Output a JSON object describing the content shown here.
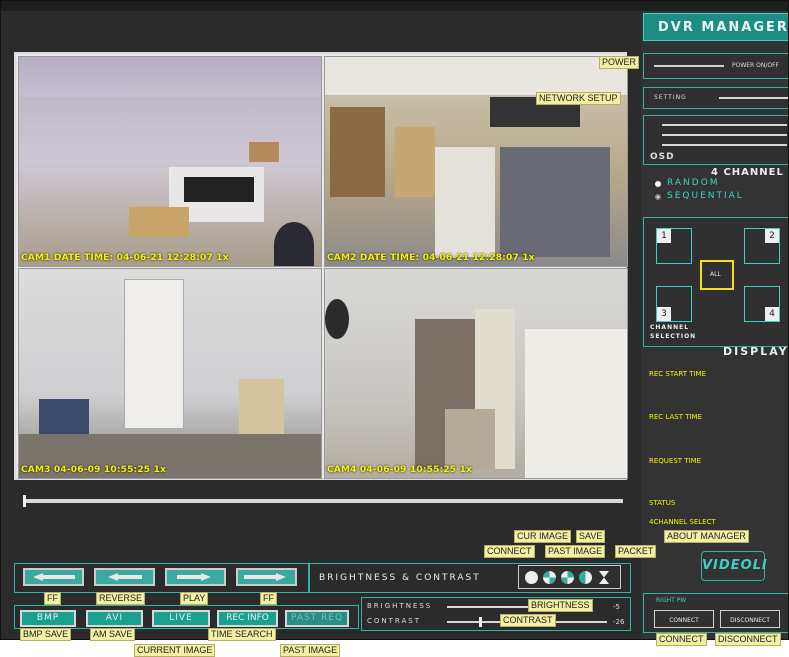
{
  "app": {
    "title": "DVR MANAGER"
  },
  "cameras": [
    {
      "caption": "CAM1 DATE TIME: 04-06-21 12:28:07   1x"
    },
    {
      "caption": "CAM2 DATE TIME: 04-06-21 12:28:07   1x"
    },
    {
      "caption": "CAM3  04-06-09 10:55:25   1x"
    },
    {
      "caption": "CAM4  04-06-09 10:55:25   1x"
    }
  ],
  "labels": {
    "power": "POWER",
    "network_setup": "NETWORK SETUP",
    "cur_image": "CUR IMAGE",
    "save": "SAVE",
    "connect": "CONNECT",
    "past_image": "PAST IMAGE",
    "packet": "PACKET",
    "about_manager": "ABOUT MANAGER",
    "ff1": "FF",
    "reverse": "REVERSE",
    "play": "PLAY",
    "ff2": "FF",
    "bmp_save": "BMP SAVE",
    "am_save": "AM SAVE",
    "time_search": "TIME SEARCH",
    "current_image": "CURRENT IMAGE",
    "past_image_bottom": "PAST IMAGE",
    "brightness": "BRIGHTNESS",
    "contrast": "CONTRAST",
    "connect_bottom": "CONNECT",
    "disconnect_bottom": "DISCONNECT"
  },
  "right_panel": {
    "power_onoff": "POWER ON/OFF",
    "setting": "SETTING",
    "osd": "OSD",
    "four_channel": "4 CHANNEL",
    "random": "RANDOM",
    "sequential": "SEQUENTIAL",
    "ch1": "1",
    "ch2": "2",
    "ch3": "3",
    "ch4": "4",
    "all": "ALL",
    "channel_selection_1": "CHANNEL",
    "channel_selection_2": "SELECTION",
    "display": "DISPLAY",
    "rec_start_time": "REC START TIME",
    "rec_last_time": "REC LAST TIME",
    "request_time": "REQUEST TIME",
    "status": "STATUS",
    "four_channel_select": "4CHANNEL SELECT",
    "logo": "VIDEOLI",
    "right_pw": "RIGHT PW",
    "connect": "CONNECT",
    "disconnect": "DISCONNECT"
  },
  "bottom": {
    "brightness_contrast_title": "BRIGHTNESS  &  CONTRAST",
    "brightness_label": "BRIGHTNESS",
    "contrast_label": "CONTRAST",
    "brightness_value": "-5",
    "contrast_value": "-26",
    "brightness_level": 0.72,
    "contrast_level": 0.2,
    "mode_buttons": [
      "BMP",
      "AVI",
      "LIVE",
      "REC INFO",
      "PAST REQ"
    ]
  },
  "colors": {
    "accent": "#3fd0c3",
    "label_bg": "#f3f0a5",
    "caption": "#f5f500",
    "background": "#2b2b2b"
  }
}
